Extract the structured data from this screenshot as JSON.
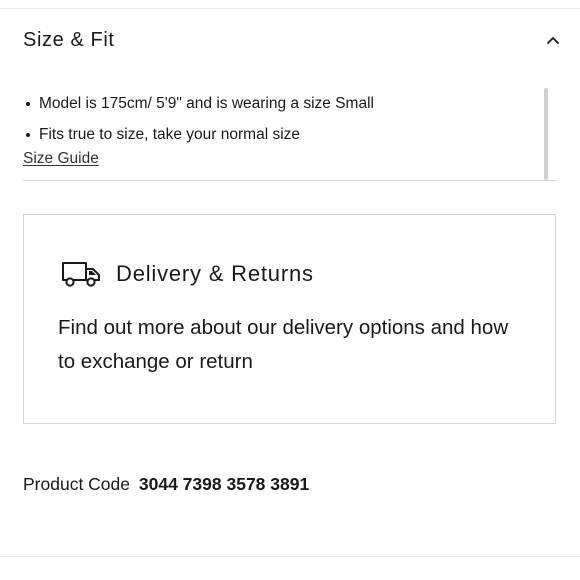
{
  "size_fit": {
    "title": "Size & Fit",
    "bullets": [
      "Model is 175cm/ 5'9\" and is wearing a size Small",
      "Fits true to size, take your normal size"
    ],
    "size_guide_link": "Size Guide"
  },
  "delivery": {
    "title": "Delivery & Returns",
    "description": "Find out more about our delivery options and how to exchange or return",
    "icon": "delivery-truck-icon"
  },
  "product": {
    "code_label": "Product Code",
    "code_value": "3044 7398 3578 3891"
  },
  "icons": {
    "collapse": "chevron-up-icon"
  }
}
